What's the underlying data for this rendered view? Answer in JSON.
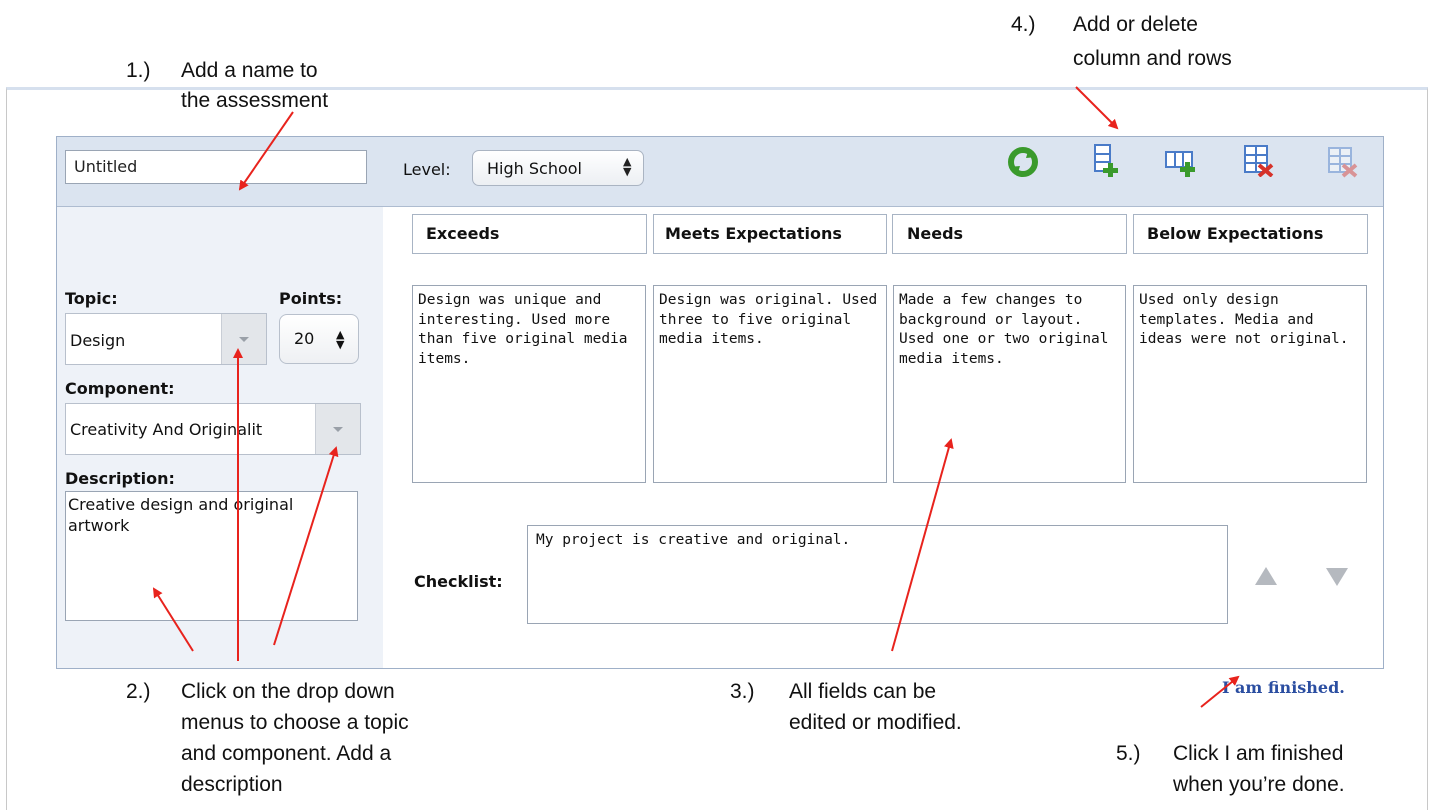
{
  "annotations": {
    "step1": {
      "num": "1.)",
      "line1": "Add a name to",
      "line2": "the assessment"
    },
    "step2": {
      "num": "2.)",
      "line1": "Click on the drop down",
      "line2": "menus to choose a topic",
      "line3": "and component.  Add a",
      "line4": "description"
    },
    "step3": {
      "num": "3.)",
      "line1": "All fields can be",
      "line2": "edited or modified."
    },
    "step4": {
      "num": "4.)",
      "line1": "Add or delete",
      "line2": "column and rows"
    },
    "step5": {
      "num": "5.)",
      "line1": "Click I am finished",
      "line2": "when you’re done."
    },
    "arrow_color": "#e8231d"
  },
  "toolbar": {
    "name_value": "Untitled",
    "level_label": "Level:",
    "level_value": "High School",
    "icons": [
      "refresh-icon",
      "add-row-icon",
      "add-column-icon",
      "delete-row-icon",
      "delete-column-icon"
    ]
  },
  "sidebar": {
    "topic_label": "Topic:",
    "topic_value": "Design",
    "points_label": "Points:",
    "points_value": "20",
    "component_label": "Component:",
    "component_value": "Creativity And Originalit",
    "description_label": "Description:",
    "description_value": "Creative design and original artwork"
  },
  "rubric": {
    "columns": [
      "Exceeds",
      "Meets Expectations",
      "Needs",
      "Below Expectations"
    ],
    "descriptions": [
      "Design was unique and interesting. Used more than five original media items.",
      "Design was original. Used three to five original media items.",
      "Made a few changes to background or layout. Used one or two original media items.",
      "Used only design templates. Media and ideas were not original."
    ],
    "checklist_label": "Checklist:",
    "checklist_value": "My project is creative and original."
  },
  "finish_link": "I am finished.",
  "colors": {
    "toolbar_bg": "#dbe4f0",
    "sidebar_bg": "#eef2f8",
    "link": "#2b4ea1",
    "icon_green": "#3a9a2c",
    "icon_blue": "#4a7bc8",
    "icon_red": "#d6322a"
  }
}
